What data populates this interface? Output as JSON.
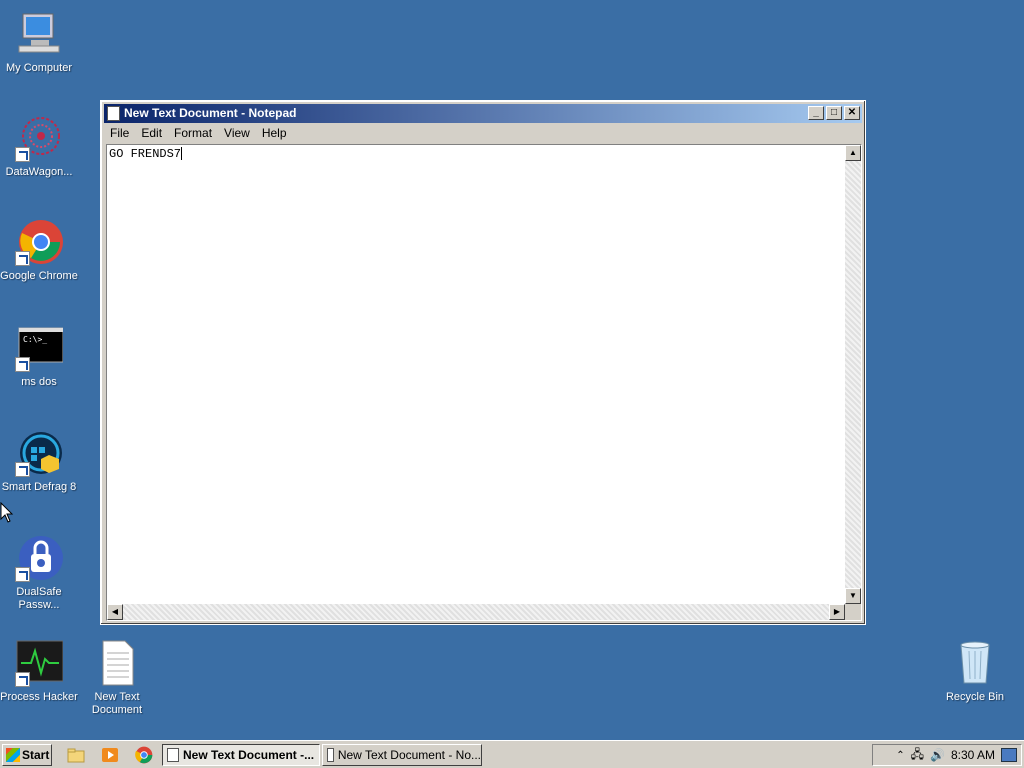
{
  "desktop": {
    "icons": [
      {
        "label": "My Computer"
      },
      {
        "label": "DataWagon..."
      },
      {
        "label": "Google Chrome"
      },
      {
        "label": "ms dos"
      },
      {
        "label": "Smart Defrag 8"
      },
      {
        "label": "DualSafe Passw..."
      },
      {
        "label": "Process Hacker"
      },
      {
        "label": "New Text Document"
      },
      {
        "label": "Recycle Bin"
      }
    ]
  },
  "window": {
    "title": "New Text Document - Notepad",
    "menu": [
      "File",
      "Edit",
      "Format",
      "View",
      "Help"
    ],
    "content": "GO FRENDS7"
  },
  "taskbar": {
    "start_label": "Start",
    "tasks": [
      {
        "label": "New Text Document -..."
      },
      {
        "label": "New Text Document - No..."
      }
    ],
    "clock": "8:30 AM"
  },
  "colors": {
    "desktop": "#3a6ea5",
    "titlebar": "#0a246a"
  }
}
